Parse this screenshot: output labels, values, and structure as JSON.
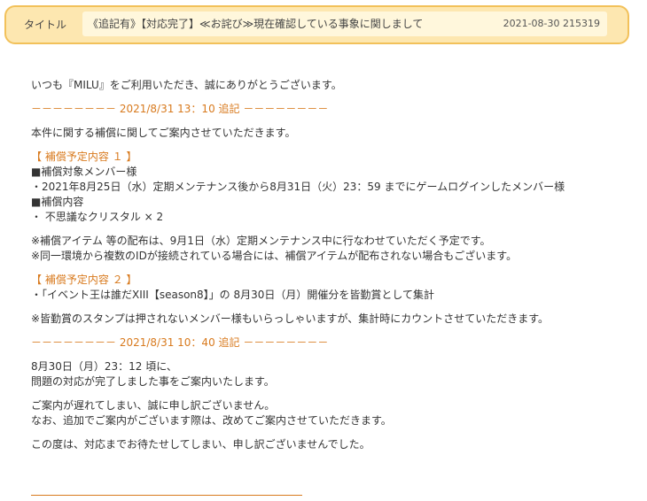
{
  "header": {
    "label": "タイトル",
    "title": "《追記有》【対応完了】≪お詫び≫現在確認している事象に関しまして",
    "date": "2021-08-30 215319"
  },
  "body": {
    "greeting": "いつも『MILU』をご利用いただき、誠にありがとうございます。",
    "sep1": "－－－－－－－－ 2021/8/31 13：10 追記 －－－－－－－－",
    "intro": "本件に関する補償に関してご案内させていただきます。",
    "plan1_title": "【 補償予定内容 １ 】",
    "plan1_target_head": "■補償対象メンバー様",
    "plan1_target": "・2021年8月25日（水）定期メンテナンス後から8月31日（火）23：59 までにゲームログインしたメンバー様",
    "plan1_content_head": "■補償内容",
    "plan1_content": "・ 不思議なクリスタル × 2",
    "note1": "※補償アイテム 等の配布は、9月1日（水）定期メンテナンス中に行なわせていただく予定です。",
    "note2": "※同一環境から複数のIDが接続されている場合には、補償アイテムが配布されない場合もございます。",
    "plan2_title": "【 補償予定内容 ２ 】",
    "plan2_item": "・「イベント王は誰だXIII【season8】」の 8月30日（月）開催分を皆勤賞として集計",
    "note3": "※皆勤賞のスタンプは押されないメンバー様もいらっしゃいますが、集計時にカウントさせていただきます。",
    "sep2": "－－－－－－－－ 2021/8/31 10：40 追記 －－－－－－－－",
    "update1": "8月30日（月）23：12 頃に、",
    "update2": "問題の対応が完了しました事をご案内いたします。",
    "apology1": "ご案内が遅れてしまい、誠に申し訳ございません。",
    "apology2": "なお、追加でご案内がございます際は、改めてご案内させていただきます。",
    "closing": "この度は、対応までお待たせしてしまい、申し訳ございませんでした。"
  },
  "colors": {
    "accent_orange": "#d87a1e",
    "header_bg": "#fde7b0",
    "header_border": "#f2c15a",
    "header_inner_bg": "#fff7dc",
    "text": "#333333"
  }
}
